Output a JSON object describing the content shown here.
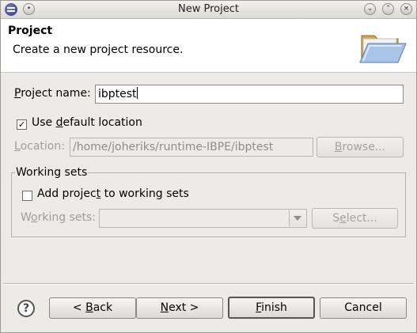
{
  "window": {
    "title": "New Project",
    "buttons": {
      "menu": "•",
      "minimize": "⌄",
      "maximize": "⌃",
      "close": "×"
    }
  },
  "banner": {
    "heading": "Project",
    "description": "Create a new project resource."
  },
  "form": {
    "project_name": {
      "label_pre": "",
      "label_u": "P",
      "label_post": "roject name:",
      "value": "ibptest"
    },
    "use_default": {
      "label_pre": "Use ",
      "label_u": "d",
      "label_post": "efault location",
      "checked": true
    },
    "location": {
      "label_pre": "",
      "label_u": "L",
      "label_post": "ocation:",
      "value": "/home/joheriks/runtime-IBPE/ibptest"
    },
    "browse": {
      "label_pre": "",
      "label_u": "B",
      "label_post": "rowse..."
    }
  },
  "working_sets": {
    "group_title": "Working sets",
    "add_checkbox": {
      "label_pre": "Add projec",
      "label_u": "t",
      "label_post": " to working sets",
      "checked": false
    },
    "select_label": {
      "label_pre": "W",
      "label_u": "o",
      "label_post": "rking sets:"
    },
    "select_value": "",
    "select_button": {
      "label_pre": "S",
      "label_u": "e",
      "label_post": "lect..."
    }
  },
  "footer": {
    "help": "?",
    "back": {
      "label_pre": "< ",
      "label_u": "B",
      "label_post": "ack"
    },
    "next": {
      "label_pre": "",
      "label_u": "N",
      "label_post": "ext >"
    },
    "finish": {
      "label_pre": "",
      "label_u": "F",
      "label_post": "inish"
    },
    "cancel": {
      "label": "Cancel"
    }
  }
}
